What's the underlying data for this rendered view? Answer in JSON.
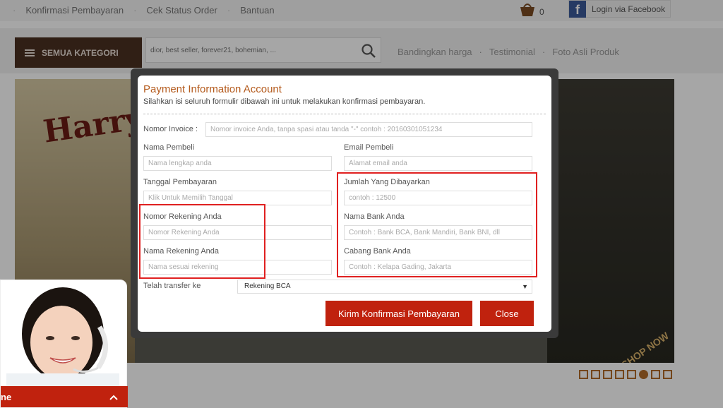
{
  "topbar": {
    "links": [
      "Konfirmasi Pembayaran",
      "Cek Status Order",
      "Bantuan"
    ],
    "cart_count": "0",
    "facebook_label": "Login via Facebook"
  },
  "nav": {
    "category_label": "SEMUA KATEGORI",
    "search_placeholder": "dior, best seller, forever21, bohemian, ...",
    "links": [
      "Bandingkan harga",
      "Testimonial",
      "Foto Asli Produk"
    ]
  },
  "banner": {
    "logo_text": "Harry",
    "badge": "SHOP NOW",
    "slide_count": 8,
    "active_slide": 6
  },
  "modal": {
    "title": "Payment Information Account",
    "subtitle": "Silahkan isi seluruh formulir dibawah ini untuk melakukan konfirmasi pembayaran.",
    "invoice_label": "Nomor Invoice :",
    "invoice_placeholder": "Nomor invoice Anda, tanpa spasi atau tanda \"-\" contoh : 20160301051234",
    "buyer_name_label": "Nama Pembeli",
    "buyer_name_placeholder": "Nama lengkap anda",
    "email_label": "Email Pembeli",
    "email_placeholder": "Alamat email anda",
    "date_label": "Tanggal Pembayaran",
    "date_placeholder": "Klik Untuk Memilih Tanggal",
    "amount_label": "Jumlah Yang Dibayarkan",
    "amount_placeholder": "contoh : 12500",
    "account_number_label": "Nomor Rekening Anda",
    "account_number_placeholder": "Nomor Rekening Anda",
    "bank_name_label": "Nama Bank Anda",
    "bank_name_placeholder": "Contoh : Bank BCA, Bank Mandiri, Bank BNI, dll",
    "account_name_label": "Nama Rekening Anda",
    "account_name_placeholder": "Nama sesuai rekening",
    "branch_label": "Cabang Bank Anda",
    "branch_placeholder": "Contoh : Kelapa Gading, Jakarta",
    "transfer_label": "Telah transfer ke",
    "transfer_value": "Rekening BCA",
    "submit_label": "Kirim Konfirmasi Pembayaran",
    "close_label": "Close"
  },
  "chat": {
    "bar_label": "ne"
  },
  "colors": {
    "accent_red": "#c0220e",
    "title_orange": "#b45a1c",
    "category_brown": "#4b3121",
    "highlight_red": "#e02020"
  }
}
